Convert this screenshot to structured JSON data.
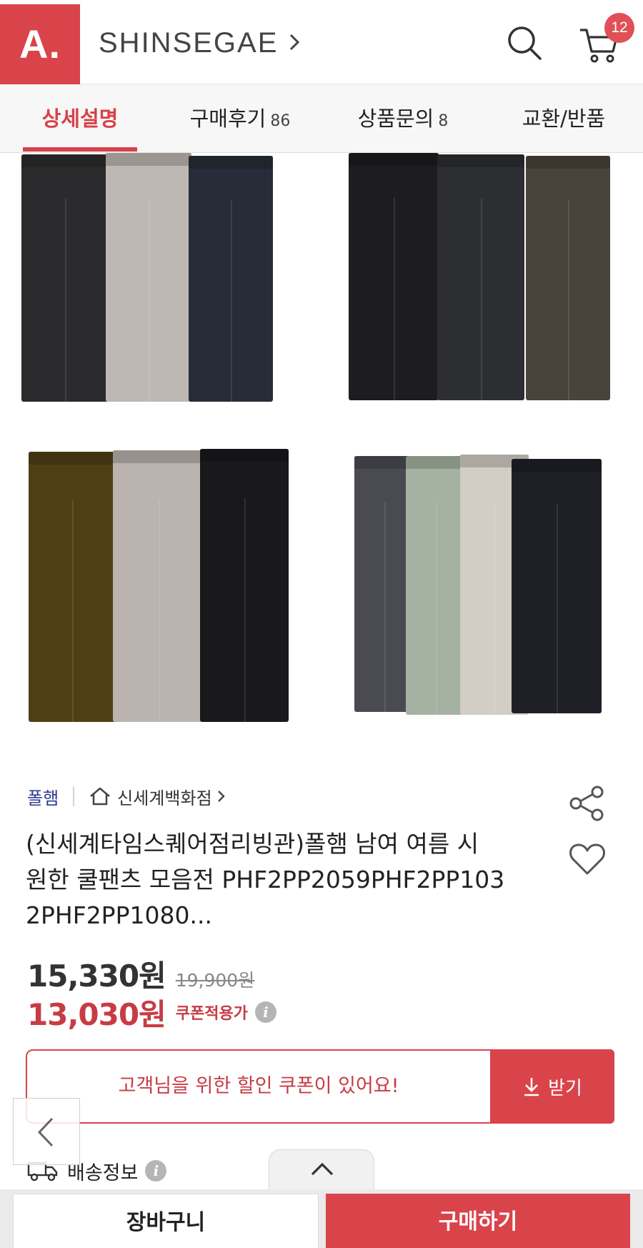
{
  "header": {
    "logo_text": "A.",
    "brand": "SHINSEGAE",
    "cart_count": "12"
  },
  "tabs": [
    {
      "label": "상세설명",
      "count": "",
      "active": true
    },
    {
      "label": "구매후기",
      "count": "86",
      "active": false
    },
    {
      "label": "상품문의",
      "count": "8",
      "active": false
    },
    {
      "label": "교환/반품",
      "count": "",
      "active": false
    }
  ],
  "product_images": {
    "groups": [
      {
        "colors": [
          "#2b2b2d",
          "#bdb8b3",
          "#282c38"
        ]
      },
      {
        "colors": [
          "#1d1d1f",
          "#2c2e32",
          "#4a433c"
        ]
      },
      {
        "colors": [
          "#4f4014",
          "#bab3ae",
          "#19191b"
        ]
      },
      {
        "colors": [
          "#4a4a52",
          "#a5b2a2",
          "#d2cdc5",
          "#1f2027"
        ]
      }
    ]
  },
  "seller": {
    "brand": "폴햄",
    "store": "신세계백화점"
  },
  "product": {
    "title_line1": "(신세계타임스퀘어점리빙관)폴햄 남여 여름 시",
    "title_line2": "원한 쿨팬츠 모음전  PHF2PP2059PHF2PP103",
    "title_line3": "2PHF2PP1080..."
  },
  "price": {
    "current": "15,330원",
    "original": "19,900원",
    "coupon_price": "13,030원",
    "coupon_label": "쿠폰적용가"
  },
  "coupon_banner": {
    "text": "고객님을 위한 할인 쿠폰이 있어요!",
    "button": "받기"
  },
  "shipping": {
    "label": "배송정보"
  },
  "bottom": {
    "cart_button": "장바구니",
    "buy_button": "구매하기"
  },
  "colors": {
    "accent": "#d9434a",
    "seller_blue": "#2a3a8c"
  }
}
